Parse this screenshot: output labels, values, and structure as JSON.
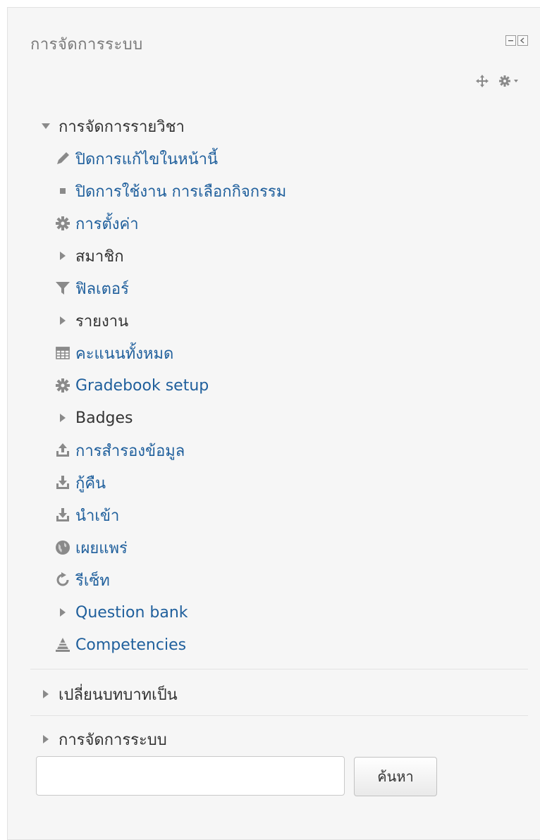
{
  "block": {
    "title": "การจัดการระบบ",
    "controls": [
      "minimize-icon",
      "dock-icon"
    ]
  },
  "actions": [
    "move-icon",
    "gear-menu-icon"
  ],
  "course_admin": {
    "label": "การจัดการรายวิชา",
    "items": [
      {
        "label": "ปิดการแก้ไขในหน้านี้",
        "icon": "pencil-icon"
      },
      {
        "label": "ปิดการใช้งาน การเลือกกิจกรรม",
        "icon": "bullet-icon"
      },
      {
        "label": "การตั้งค่า",
        "icon": "gear-icon"
      },
      {
        "label": "สมาชิก",
        "icon": "expand-arrow-icon"
      },
      {
        "label": "ฟิลเตอร์",
        "icon": "filter-icon"
      },
      {
        "label": "รายงาน",
        "icon": "expand-arrow-icon"
      },
      {
        "label": "คะแนนทั้งหมด",
        "icon": "table-icon"
      },
      {
        "label": "Gradebook setup",
        "icon": "gear-icon"
      },
      {
        "label": "Badges",
        "icon": "expand-arrow-icon"
      },
      {
        "label": "การสำรองข้อมูล",
        "icon": "upload-icon"
      },
      {
        "label": "กู้คืน",
        "icon": "download-icon"
      },
      {
        "label": "นำเข้า",
        "icon": "download-icon"
      },
      {
        "label": "เผยแพร่",
        "icon": "globe-icon"
      },
      {
        "label": "รีเซ็ท",
        "icon": "reset-icon"
      },
      {
        "label": "Question bank",
        "icon": "expand-arrow-icon"
      },
      {
        "label": "Competencies",
        "icon": "competencies-icon"
      }
    ]
  },
  "switch_role": {
    "label": "เปลี่ยนบทบาทเป็น"
  },
  "site_admin": {
    "label": "การจัดการระบบ"
  },
  "search": {
    "placeholder": "",
    "button": "ค้นหา"
  },
  "colors": {
    "link": "#1f5f9c",
    "text": "#333333",
    "icon": "#8a8a8a",
    "background": "#f6f6f6"
  }
}
